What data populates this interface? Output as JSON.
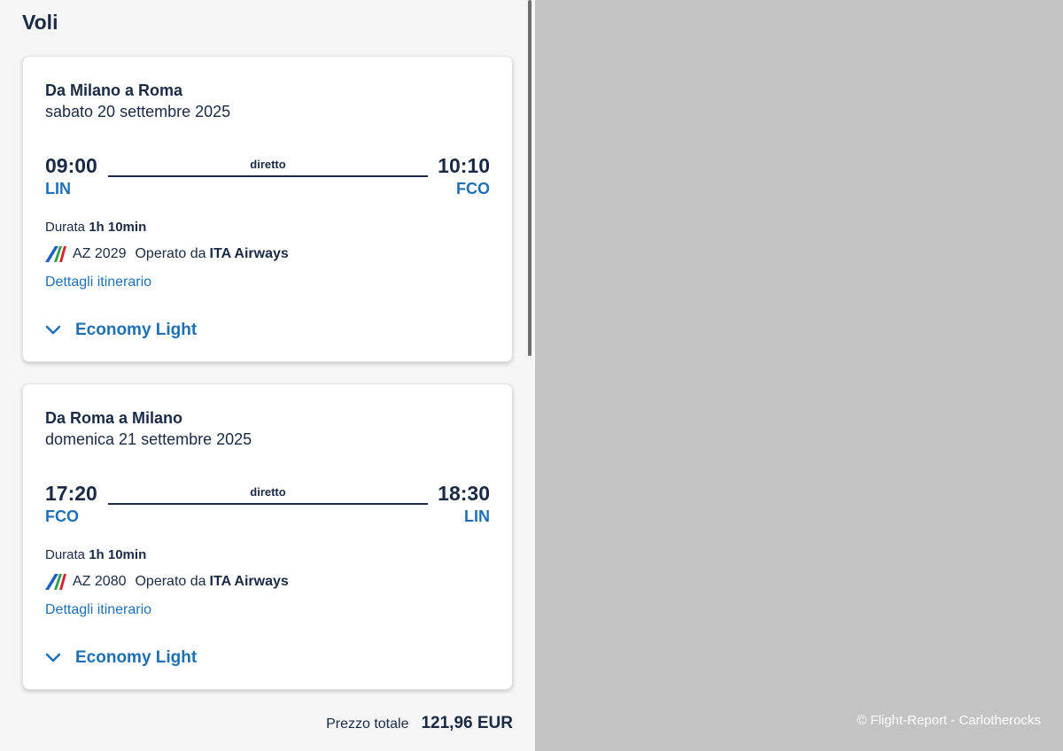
{
  "heading": "Voli",
  "flights": [
    {
      "route": "Da Milano a Roma",
      "date": "sabato 20 settembre 2025",
      "departure_time": "09:00",
      "arrival_time": "10:10",
      "stops": "diretto",
      "departure_airport": "LIN",
      "arrival_airport": "FCO",
      "duration_label": "Durata",
      "duration_value": "1h 10min",
      "flight_number": "AZ 2029",
      "operated_by_label": "Operato da",
      "carrier": "ITA Airways",
      "details_link": "Dettagli itinerario",
      "fare": "Economy Light"
    },
    {
      "route": "Da Roma a Milano",
      "date": "domenica 21 settembre 2025",
      "departure_time": "17:20",
      "arrival_time": "18:30",
      "stops": "diretto",
      "departure_airport": "FCO",
      "arrival_airport": "LIN",
      "duration_label": "Durata",
      "duration_value": "1h 10min",
      "flight_number": "AZ 2080",
      "operated_by_label": "Operato da",
      "carrier": "ITA Airways",
      "details_link": "Dettagli itinerario",
      "fare": "Economy Light"
    }
  ],
  "total": {
    "label": "Prezzo totale",
    "value": "121,96 EUR"
  },
  "watermark": "© Flight-Report - Carlotherocks",
  "colors": {
    "text_dark": "#1a2a44",
    "accent_blue": "#1f6fb5",
    "panel_bg": "#f5f5f5",
    "backdrop": "#c3c3c3"
  },
  "icons": {
    "airline_logo": "ita-airways-logo",
    "fare_toggle": "chevron-down-icon"
  }
}
